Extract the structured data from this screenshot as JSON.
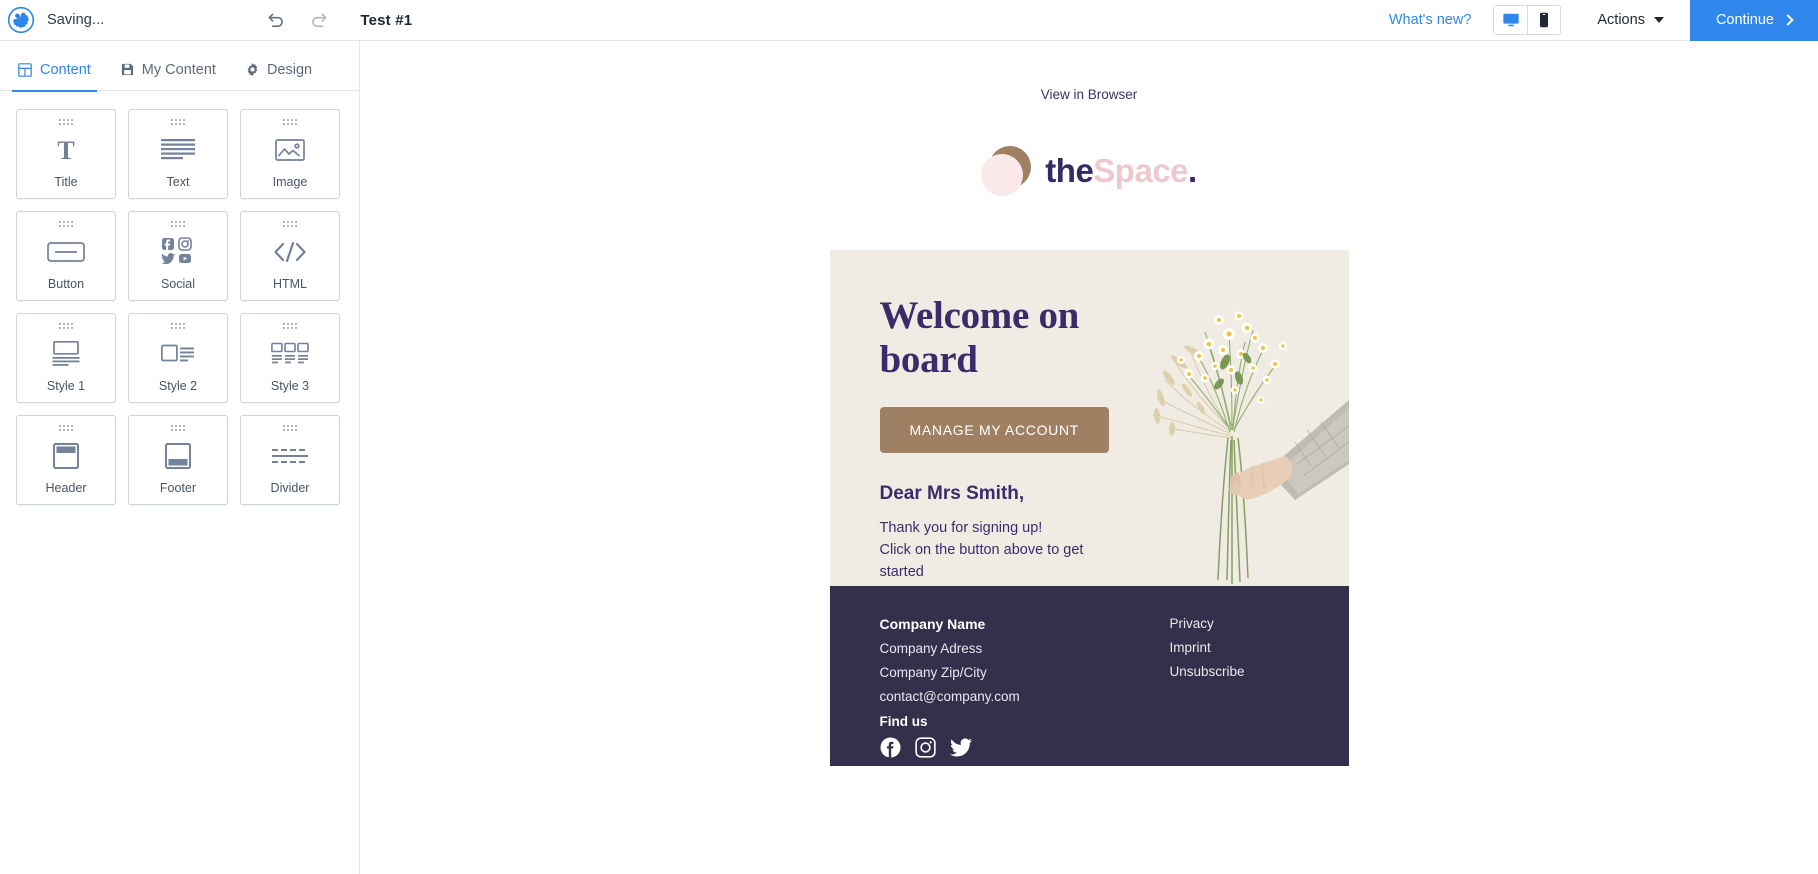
{
  "topbar": {
    "brand_icon": "pinwheel-logo-icon",
    "status": "Saving...",
    "undo_icon": "undo-icon",
    "redo_icon": "redo-icon",
    "doc_title": "Test #1",
    "whats_new": "What's new?",
    "desktop_icon": "desktop-monitor-icon",
    "mobile_icon": "mobile-phone-icon",
    "actions_label": "Actions",
    "continue_label": "Continue",
    "accent_color": "#2f86eb"
  },
  "sidebar": {
    "tabs": [
      {
        "label": "Content",
        "icon": "grid-layout-icon",
        "active": true
      },
      {
        "label": "My Content",
        "icon": "save-disk-icon",
        "active": false
      },
      {
        "label": "Design",
        "icon": "gear-icon",
        "active": false
      }
    ],
    "blocks": [
      {
        "label": "Title",
        "icon": "serif-t-icon"
      },
      {
        "label": "Text",
        "icon": "text-lines-icon"
      },
      {
        "label": "Image",
        "icon": "picture-mountain-icon"
      },
      {
        "label": "Button",
        "icon": "rounded-button-icon"
      },
      {
        "label": "Social",
        "icon": "social-networks-icon"
      },
      {
        "label": "HTML",
        "icon": "code-brackets-icon"
      },
      {
        "label": "Style 1",
        "icon": "image-over-text-icon"
      },
      {
        "label": "Style 2",
        "icon": "image-left-text-right-icon"
      },
      {
        "label": "Style 3",
        "icon": "three-columns-icon"
      },
      {
        "label": "Header",
        "icon": "header-block-icon"
      },
      {
        "label": "Footer",
        "icon": "footer-block-icon"
      },
      {
        "label": "Divider",
        "icon": "divider-dashed-icon"
      }
    ]
  },
  "email": {
    "view_in_browser": "View in Browser",
    "logo": {
      "part_one": "the",
      "part_two": "Space",
      "dot": ".",
      "circle_brown": "#a08063",
      "circle_pink": "#fbe9ea",
      "text_dark": "#372963",
      "text_pink": "#edc8cd"
    },
    "hero": {
      "background": "#f0ece4",
      "title": "Welcome on board",
      "cta_label": "MANAGE MY ACCOUNT",
      "cta_color": "#a08063",
      "greeting": "Dear Mrs Smith,",
      "line_one": "Thank you for signing up!",
      "line_two": "Click on the button above to get started",
      "photo_alt": "hand-holding-chamomile-bouquet"
    },
    "footer": {
      "background": "#32304a",
      "company_name": "Company Name",
      "address": "Company Adress",
      "zip_city": "Company Zip/City",
      "email": "contact@company.com",
      "find_us": "Find us",
      "socials": [
        {
          "name": "facebook-icon"
        },
        {
          "name": "instagram-icon"
        },
        {
          "name": "twitter-icon"
        }
      ],
      "links": [
        "Privacy",
        "Imprint",
        "Unsubscribe"
      ]
    }
  }
}
